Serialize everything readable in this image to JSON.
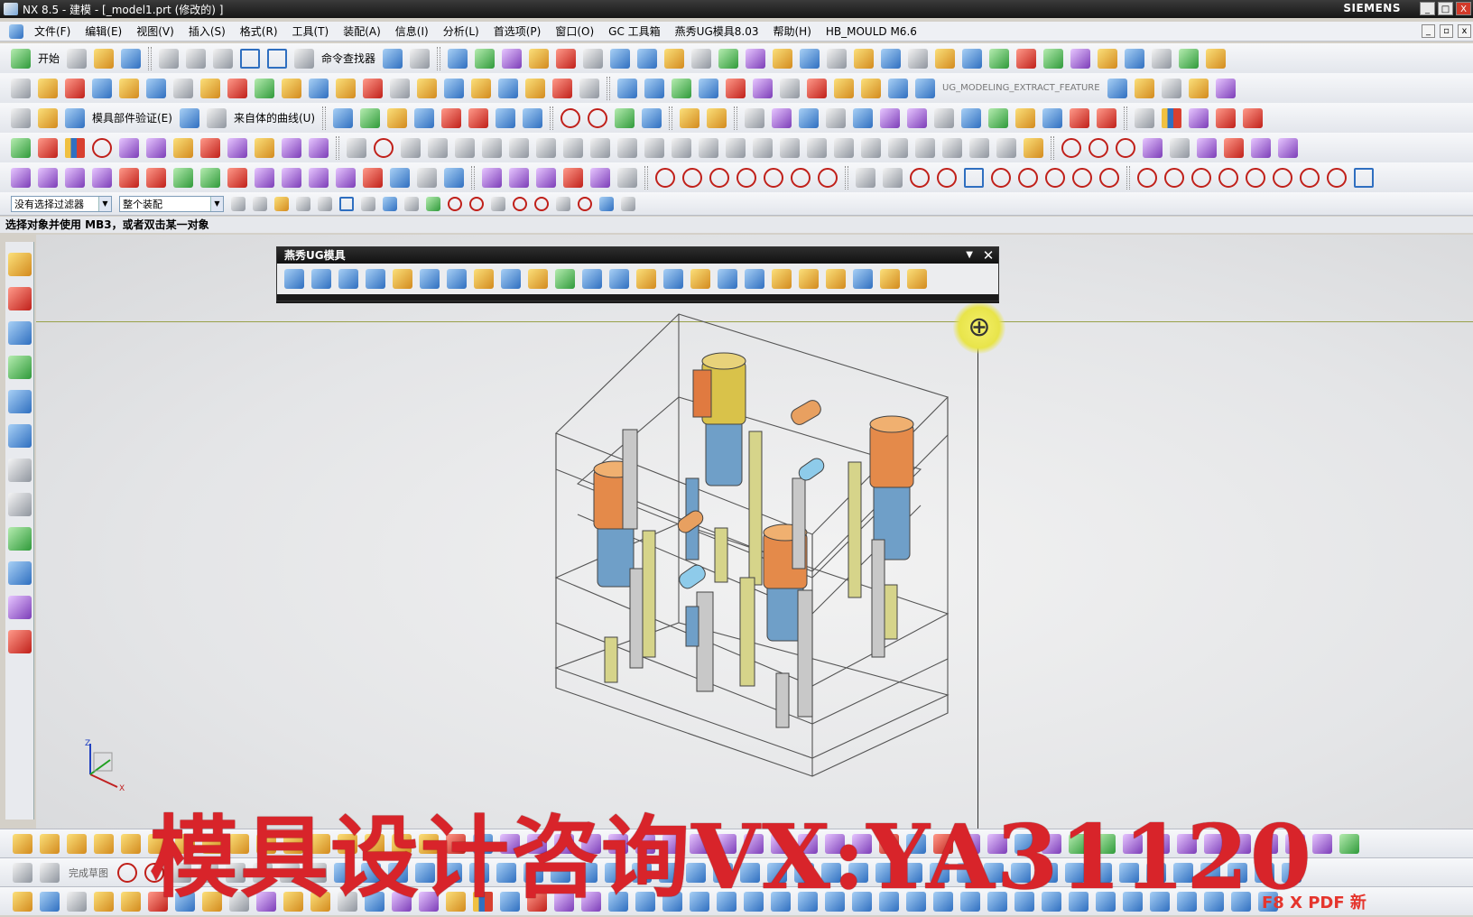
{
  "window": {
    "title": "NX 8.5 - 建模 - [_model1.prt (修改的) ]",
    "brand": "SIEMENS",
    "buttons": [
      "_",
      "□",
      "X"
    ]
  },
  "menubar": {
    "items": [
      "文件(F)",
      "编辑(E)",
      "视图(V)",
      "插入(S)",
      "格式(R)",
      "工具(T)",
      "装配(A)",
      "信息(I)",
      "分析(L)",
      "首选项(P)",
      "窗口(O)",
      "GC 工具箱",
      "燕秀UG模具8.03",
      "帮助(H)",
      "HB_MOULD M6.6"
    ]
  },
  "toolbar1": {
    "start_label": "开始",
    "command_finder_label": "命令查找器"
  },
  "toolbar2": {
    "extract_feature_label": "UG_MODELING_EXTRACT_FEATURE"
  },
  "toolbar3": {
    "mold_verify_label": "模具部件验证(E)",
    "curve_from_body_label": "来自体的曲线(U)"
  },
  "filterbar": {
    "selection_filter": "没有选择过滤器",
    "assembly_scope": "整个装配"
  },
  "status": {
    "prompt": "选择对象并使用 MB3，或者双击某一对象"
  },
  "palette": {
    "title": "燕秀UG模具"
  },
  "axes": {
    "z": "Z",
    "x": "X"
  },
  "bottombar": {
    "finish_sketch_label": "完成草图"
  },
  "watermark": {
    "text": "模具设计咨询VX:YA31120",
    "tail": "F8  X  PDF 新"
  },
  "colors": {
    "titlebar": "#151515",
    "accent_yellow": "#e8e44a",
    "watermark_red": "#d8242a"
  }
}
